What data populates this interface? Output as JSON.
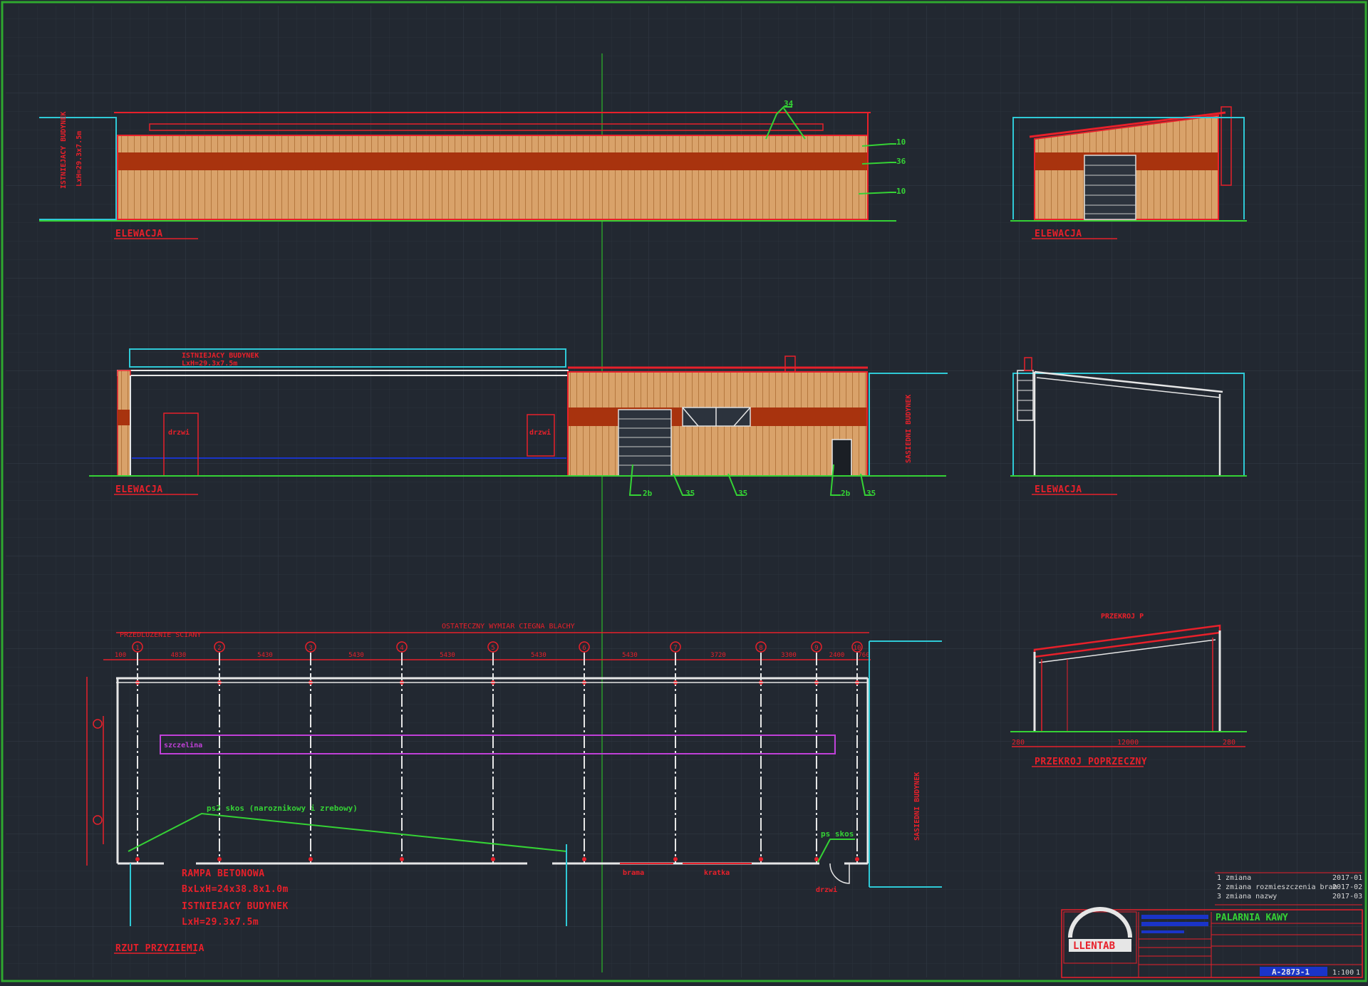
{
  "colors": {
    "background": "#222831",
    "grid_minor": "#2c333d",
    "grid_major": "#343c47",
    "frame": "#2fa82f",
    "wood": "#d9a26a",
    "wood_line": "#b5783f",
    "band": "#a8330e",
    "red": "#e8202a",
    "cyan": "#2fc9d6",
    "green": "#35d235",
    "white": "#e6e6e6",
    "magenta": "#c040d8",
    "blue": "#1a34c8"
  },
  "views": {
    "elevation_1_label": "ELEWACJA",
    "elevation_2_label": "ELEWACJA",
    "elevation_3_label": "ELEWACJA",
    "elevation_4_label": "ELEWACJA",
    "plan_label": "RZUT PRZYZIEMIA",
    "section_label": "PRZEKROJ POPRZECZNY",
    "section_title": "PRZEKROJ P"
  },
  "callouts": {
    "c1": "34",
    "c2": "10",
    "c3": "36",
    "c4": "10",
    "c5": "2b",
    "c6": "35",
    "c7": "35",
    "c8": "2b",
    "c9": "35"
  },
  "annotations": {
    "existing_building_top": "ISTNIEJACY BUDYNEK",
    "existing_building_top_dim": "LxH=29.3x7.5m",
    "rampa_line1": "RAMPA BETONOWA",
    "rampa_line2": "BxLxH=24x38.8x1.0m",
    "istn_line1": "ISTNIEJACY BUDYNEK",
    "istn_line2": "LxH=29.3x7.5m",
    "green_note": "ps2 skos (naroznikowy i zrebowy)",
    "green_note2": "ps skos",
    "plan_top_dim": "OSTATECZNY WYMIAR CIEGNA BLACHY",
    "plan_left_top": "PRZEDLUZENIE SCIANY",
    "east_side": "SASIEDNI BUDYNEK",
    "door_note": "drzwi",
    "opening_note": "brama",
    "grate_note": "kratka",
    "purple_label": "szczelina"
  },
  "plan": {
    "axes": [
      "1",
      "2",
      "3",
      "4",
      "5",
      "6",
      "7",
      "8",
      "9",
      "10"
    ],
    "dims": [
      "100",
      "4830",
      "5430",
      "5430",
      "5430",
      "5430",
      "5430",
      "3720",
      "3300",
      "2400",
      "760"
    ]
  },
  "section": {
    "span": "12000",
    "left_edge": "280",
    "right_edge": "280"
  },
  "title_block": {
    "company_logo_text": "LLENTAB",
    "project_title": "PALARNIA KAWY",
    "drawing_number": "A-2873-1",
    "rev_rows": [
      "1  zmiana",
      "2  zmiana rozmieszczenia bram",
      "3  zmiana nazwy"
    ],
    "rev_dates": [
      "2017-01",
      "2017-02",
      "2017-03"
    ],
    "scale": "1:100",
    "sheet": "1"
  }
}
